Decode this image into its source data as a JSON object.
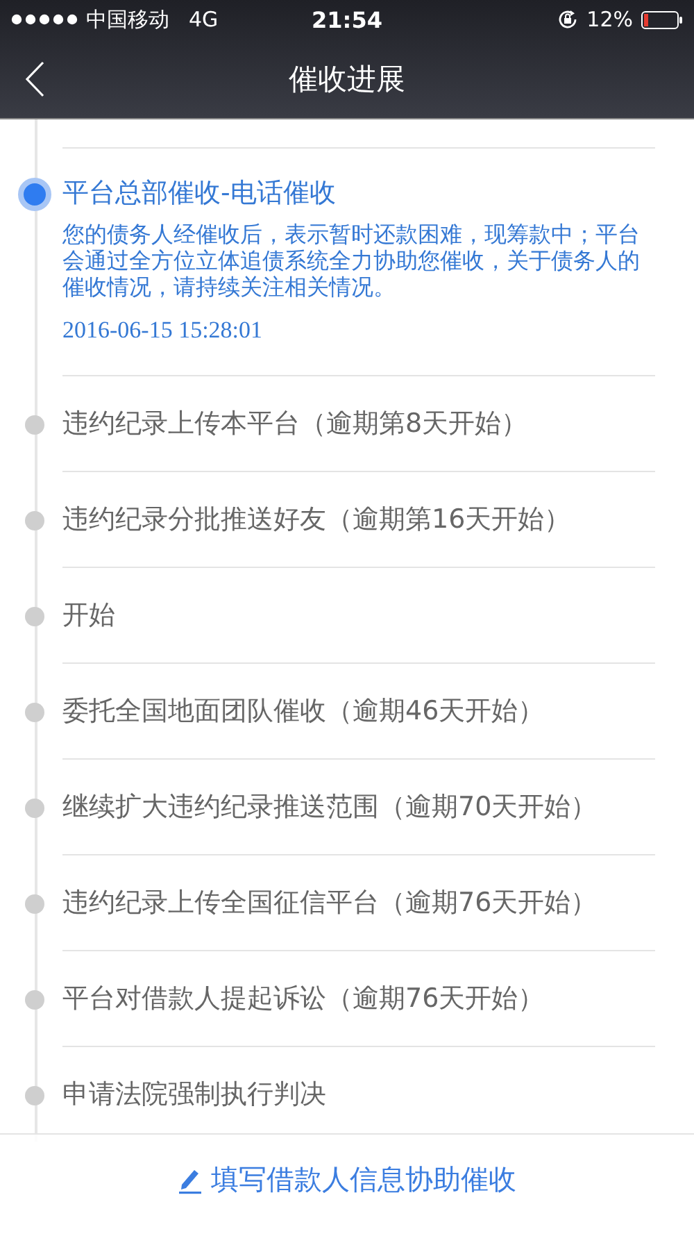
{
  "status_bar": {
    "carrier": "中国移动",
    "network": "4G",
    "time": "21:54",
    "battery_text": "12%"
  },
  "nav": {
    "title": "催收进展"
  },
  "timeline": [
    {
      "title": "平台总部催收-电话催收",
      "active": true,
      "description": "您的债务人经催收后，表示暂时还款困难，现筹款中；平台会通过全方位立体追债系统全力协助您催收，关于债务人的催收情况，请持续关注相关情况。",
      "time": "2016-06-15 15:28:01"
    },
    {
      "title": "违约纪录上传本平台（逾期第8天开始）",
      "active": false
    },
    {
      "title": "违约纪录分批推送好友（逾期第16天开始）",
      "active": false
    },
    {
      "title": "开始",
      "active": false
    },
    {
      "title": "委托全国地面团队催收（逾期46天开始）",
      "active": false
    },
    {
      "title": "继续扩大违约纪录推送范围（逾期70天开始）",
      "active": false
    },
    {
      "title": "违约纪录上传全国征信平台（逾期76天开始）",
      "active": false
    },
    {
      "title": "平台对借款人提起诉讼（逾期76天开始）",
      "active": false
    },
    {
      "title": "申请法院强制执行判决",
      "active": false
    }
  ],
  "footer_button": {
    "label": "填写借款人信息协助催收"
  }
}
